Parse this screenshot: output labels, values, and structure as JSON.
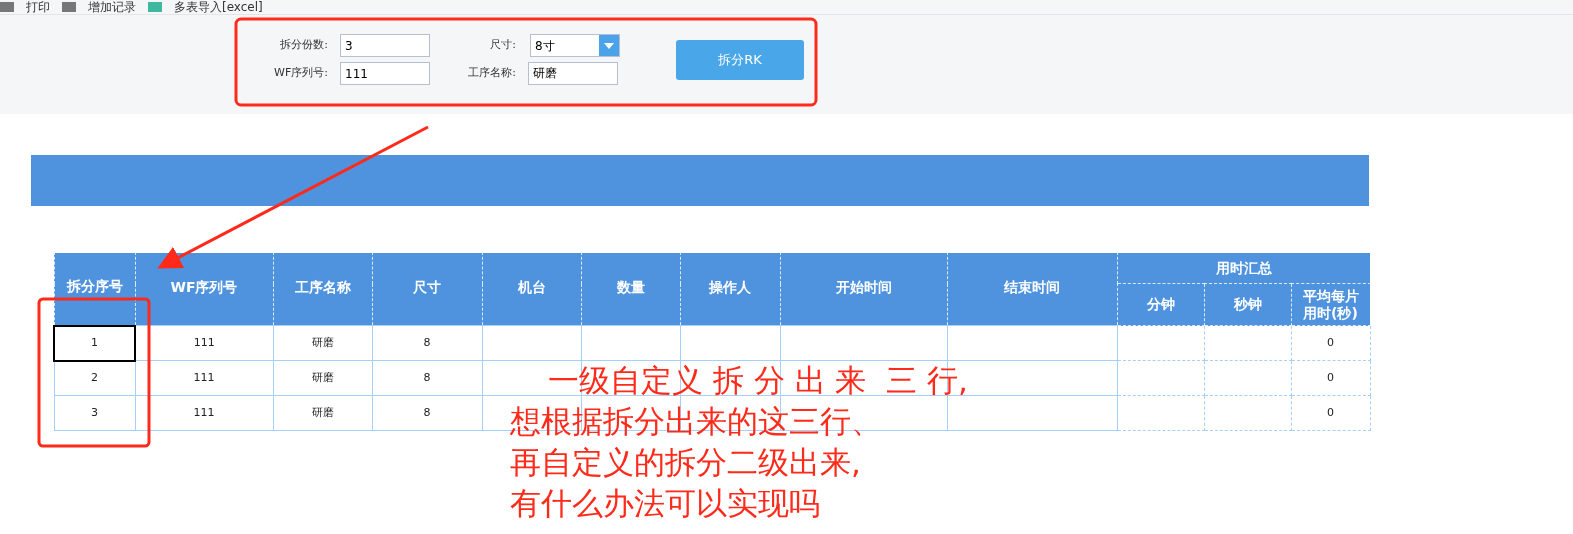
{
  "toolbar": [
    "打印",
    "增加记录",
    "多表导入[excel]"
  ],
  "form": {
    "fields": [
      {
        "label": "拆分份数:",
        "value": "3",
        "kind": "text"
      },
      {
        "label": "尺寸:",
        "value": "8寸",
        "kind": "select"
      },
      {
        "label": "WF序列号:",
        "value": "111",
        "kind": "text"
      },
      {
        "label": "工序名称:",
        "value": "研磨",
        "kind": "text"
      }
    ],
    "button": "拆分RK"
  },
  "table": {
    "group_header": {
      "label": "用时汇总"
    },
    "columns": [
      {
        "label": "拆分序号",
        "kind": "plain"
      },
      {
        "label": "WF序列号",
        "kind": "plain"
      },
      {
        "label": "工序名称",
        "kind": "plain"
      },
      {
        "label": "尺寸",
        "kind": "plain"
      },
      {
        "label": "机台",
        "kind": "plain"
      },
      {
        "label": "数量",
        "kind": "plain"
      },
      {
        "label": "操作人",
        "kind": "plain"
      },
      {
        "label": "开始时间",
        "kind": "plain"
      },
      {
        "label": "结束时间",
        "kind": "plain"
      },
      {
        "label": "分钟",
        "kind": "grouped"
      },
      {
        "label": "秒钟",
        "kind": "grouped"
      },
      {
        "label": "平均每片用时(秒)",
        "kind": "grouped"
      }
    ],
    "rows": [
      {
        "selected": true,
        "cells": [
          "1",
          "111",
          "研磨",
          "8",
          null,
          null,
          null,
          null,
          null,
          null,
          null,
          "0"
        ]
      },
      {
        "selected": false,
        "cells": [
          "2",
          "111",
          "研磨",
          "8",
          null,
          null,
          null,
          null,
          null,
          null,
          null,
          "0"
        ]
      },
      {
        "selected": false,
        "cells": [
          "3",
          "111",
          "研磨",
          "8",
          null,
          null,
          null,
          null,
          null,
          null,
          null,
          "0"
        ]
      }
    ]
  },
  "annotation": [
    "一级自定义 拆 分 出 来  三 行,",
    "想根据拆分出来的这三行、",
    "再自定义的拆分二级出来,",
    "有什么办法可以实现吗"
  ]
}
